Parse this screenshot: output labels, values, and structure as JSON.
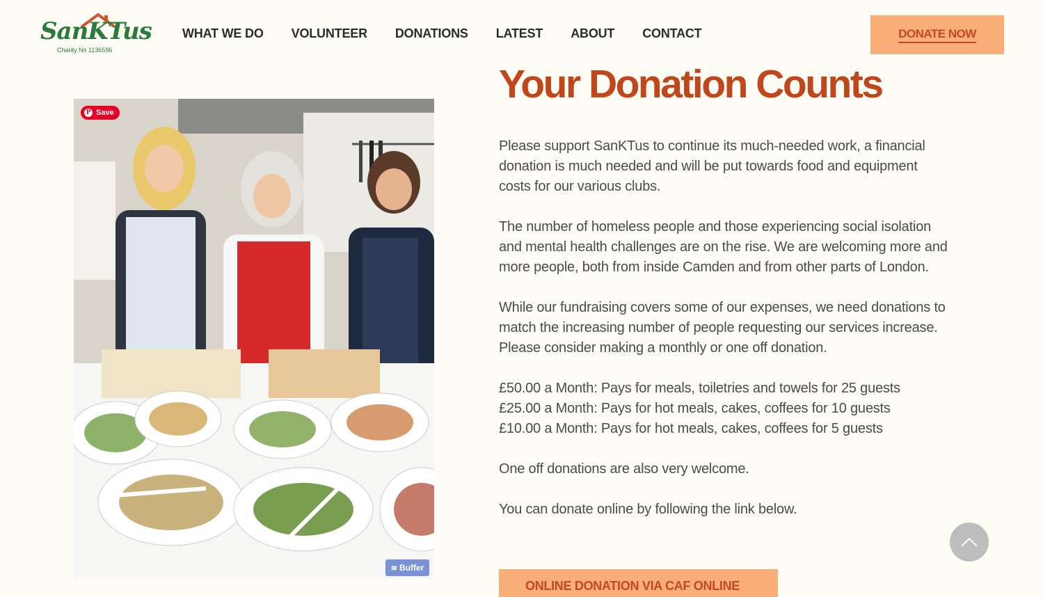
{
  "header": {
    "logo_text": "SanKTus",
    "logo_sub": "Charity No 1136596",
    "nav": [
      "WHAT WE DO",
      "VOLUNTEER",
      "DONATIONS",
      "LATEST",
      "ABOUT",
      "CONTACT"
    ],
    "donate_label": "DONATE NOW"
  },
  "photo": {
    "pin_label": "Save",
    "buffer_label": "Buffer"
  },
  "main": {
    "title": "Your Donation Counts",
    "para1": "Please support SanKTus to continue its much-needed work, a financial donation is much needed and will be put towards food and equipment costs for our various clubs.",
    "para2": "The number of homeless people and those experiencing social isolation and mental health challenges are on the rise. We are welcoming more and more people, both from inside Camden and from other parts of London.",
    "para3": "While our fundraising covers some of our expenses, we need donations to match the increasing number of people requesting our services increase. Please consider making a monthly or one off donation.",
    "tiers": [
      "£50.00 a Month: Pays for meals, toiletries and towels for 25 guests",
      "£25.00 a Month: Pays for hot meals, cakes, coffees for 10 guests",
      "£10.00 a Month: Pays for hot meals, cakes, coffees for 5 guests"
    ],
    "para4": "One off donations are also very welcome.",
    "para5": "You can donate online by following the link below.",
    "cta_label": "ONLINE DONATION VIA CAF ONLINE"
  },
  "colors": {
    "accent": "#c0471c",
    "button_bg": "#f9ae78",
    "logo_green": "#2a7a3b",
    "page_bg": "#fdfcf5"
  },
  "icons": [
    "pinterest-icon",
    "buffer-icon",
    "chevron-up-icon"
  ]
}
